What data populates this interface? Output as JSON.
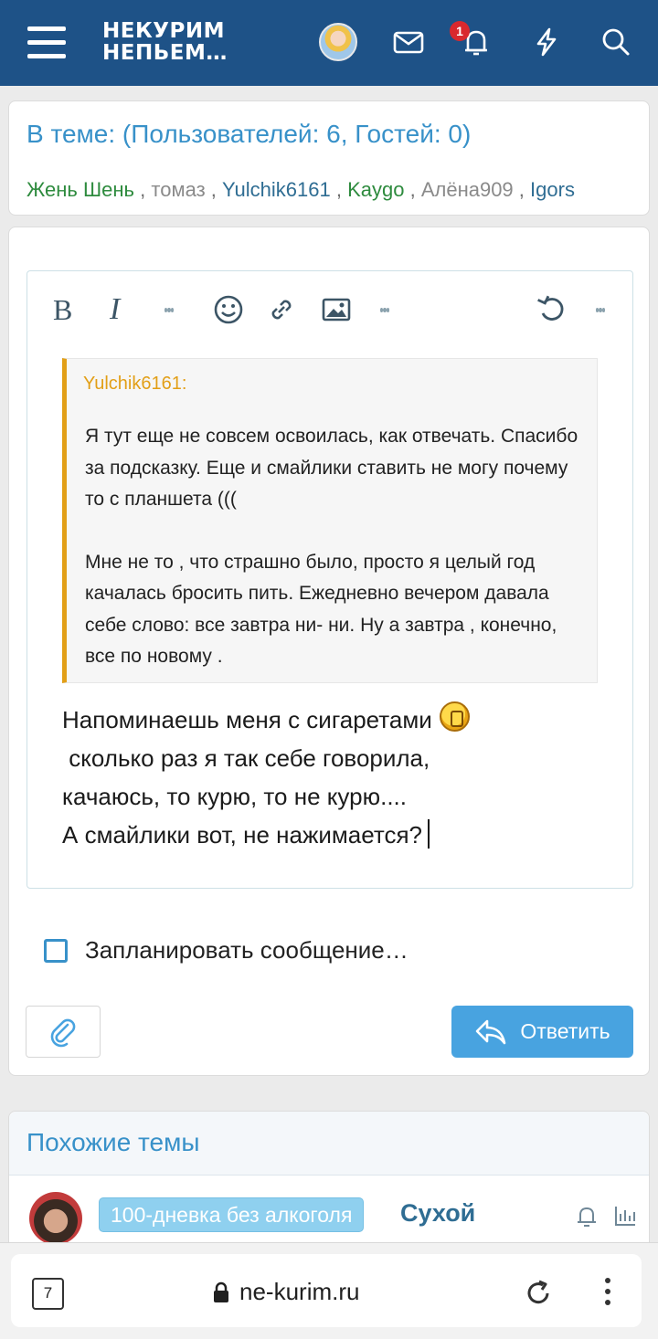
{
  "header": {
    "logo_line1": "НЕКУРИМ",
    "logo_line2": "НЕПЬЕМ…",
    "notification_count": "1",
    "icons": [
      "menu-icon",
      "avatar",
      "mail-icon",
      "bell-icon",
      "lightning-icon",
      "search-icon"
    ]
  },
  "online": {
    "title": "В теме: (Пользователей: 6, Гостей: 0)",
    "users": [
      {
        "name": "Жень Шень",
        "color": "#2e8b3e"
      },
      {
        "name": "томаз",
        "color": "#8a8a8a"
      },
      {
        "name": "Yulchik6161",
        "color": "#2f6d93"
      },
      {
        "name": "Kaygo",
        "color": "#2e8b3e"
      },
      {
        "name": "Алёна909",
        "color": "#8a8a8a"
      },
      {
        "name": "Igors",
        "color": "#2f6d93"
      }
    ],
    "separator": ","
  },
  "editor": {
    "toolbar": {
      "bold": "B",
      "italic": "I",
      "icons": [
        "more-icon",
        "smiley-icon",
        "link-icon",
        "image-icon",
        "more-icon",
        "undo-icon",
        "more-icon"
      ]
    },
    "quote": {
      "author": "Yulchik6161:",
      "para1": "Я тут еще не совсем освоилась, как отвечать. Спасибо за подсказку. Еще и смайлики ставить не могу почему то с планшета (((",
      "para2": "Мне не то , что страшно было, просто я целый год качалась бросить пить. Ежедневно вечером давала себе слово: все завтра ни- ни.   Ну а завтра , конечно, все по новому ."
    },
    "message": {
      "line1": "Напоминаешь меня с сигаретами",
      "line2": " сколько раз я так себе говорила,",
      "line3": "качаюсь, то курю, то не курю....",
      "line4": "А смайлики вот, не нажимается?"
    }
  },
  "schedule": {
    "label": "Запланировать сообщение…",
    "checked": false
  },
  "actions": {
    "reply_label": "Ответить"
  },
  "similar": {
    "title": "Похожие темы",
    "thread": {
      "prefix": "100-дневка без алкоголя",
      "title": "Сухой"
    }
  },
  "browser": {
    "tab_count": "7",
    "url": "ne-kurim.ru"
  },
  "colors": {
    "header": "#1e5287",
    "accent": "#3891c9",
    "quote_bar": "#e29f17",
    "reply_button": "#48a3e0",
    "badge": "#d9282e"
  }
}
